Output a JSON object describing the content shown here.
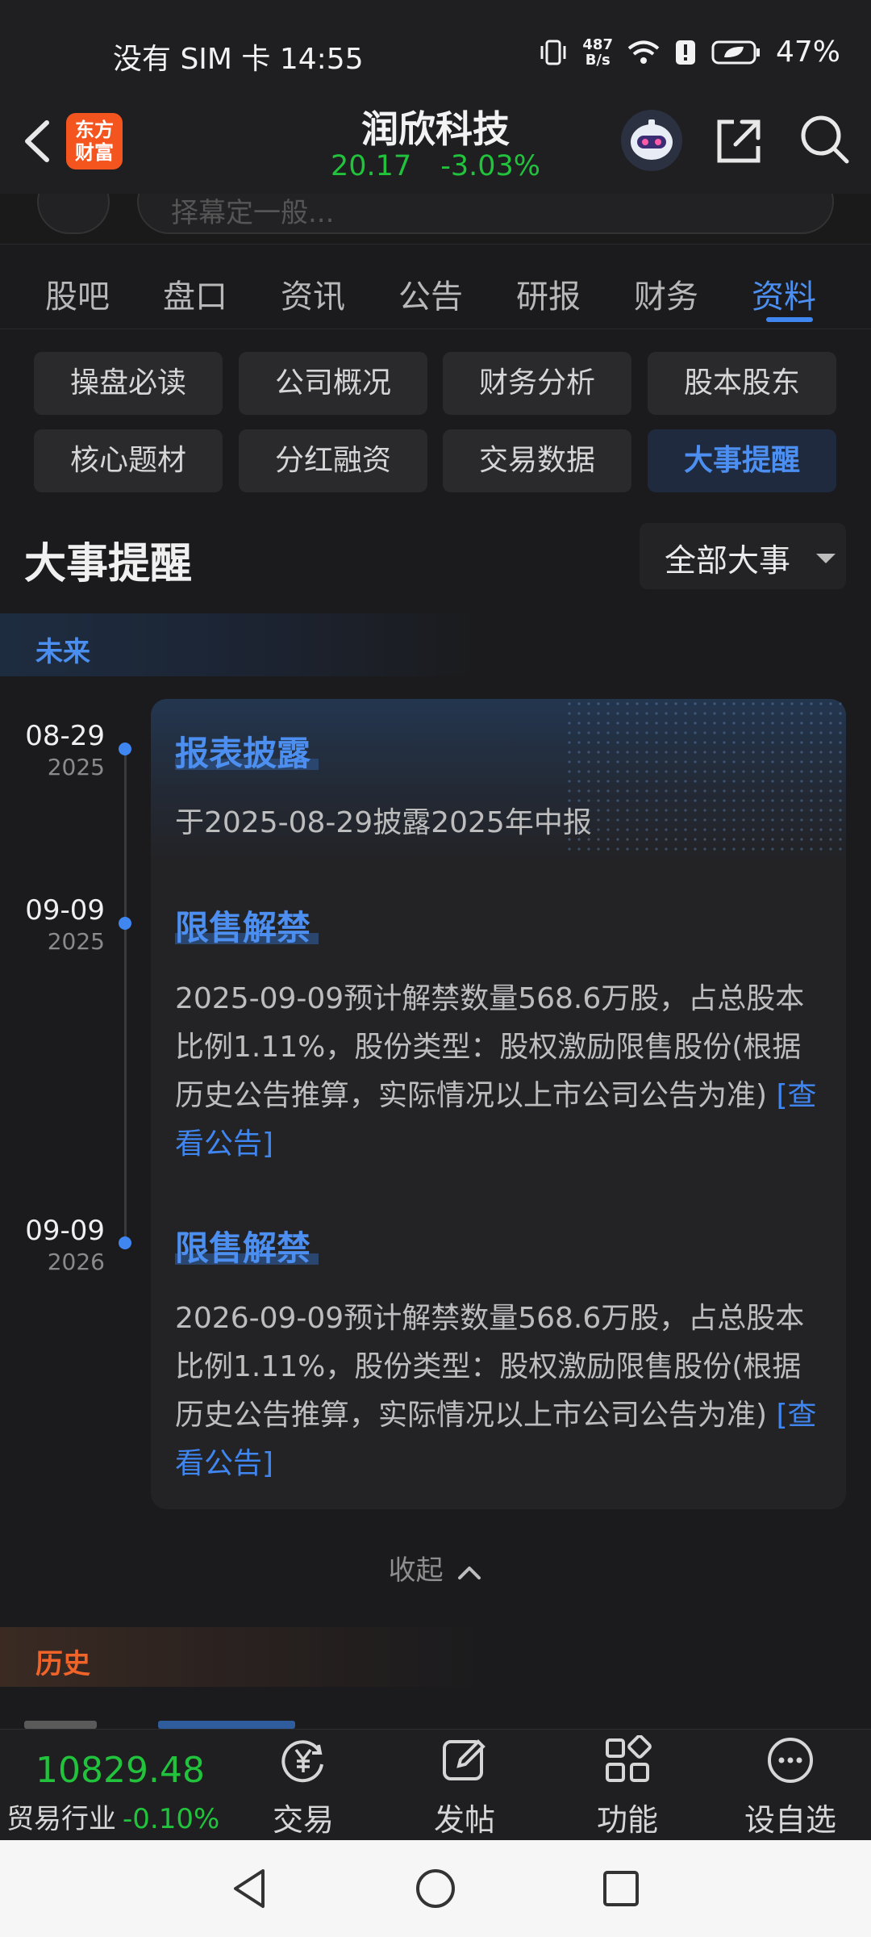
{
  "status_bar": {
    "left_text": "没有 SIM 卡 14:55",
    "net_speed_value": "487",
    "net_speed_unit": "B/s",
    "battery": "47%"
  },
  "header": {
    "logo_text": "东方\n财富",
    "stock_name": "润欣科技",
    "price": "20.17",
    "change_pct": "-3.03%"
  },
  "search_strip": {
    "placeholder_fragment": "择幕定一般..."
  },
  "tabs": [
    {
      "label": "股吧"
    },
    {
      "label": "盘口"
    },
    {
      "label": "资讯"
    },
    {
      "label": "公告"
    },
    {
      "label": "研报"
    },
    {
      "label": "财务"
    },
    {
      "label": "资料",
      "active": true
    }
  ],
  "sub_tabs": [
    {
      "label": "操盘必读"
    },
    {
      "label": "公司概况"
    },
    {
      "label": "财务分析"
    },
    {
      "label": "股本股东"
    },
    {
      "label": "核心题材"
    },
    {
      "label": "分红融资"
    },
    {
      "label": "交易数据"
    },
    {
      "label": "大事提醒",
      "active": true
    }
  ],
  "section": {
    "title": "大事提醒",
    "filter": "全部大事"
  },
  "future": {
    "label": "未来",
    "events": [
      {
        "date": "08-29",
        "year": "2025",
        "title": "报表披露",
        "text": "于2025-08-29披露2025年中报"
      },
      {
        "date": "09-09",
        "year": "2025",
        "title": "限售解禁",
        "text": "2025-09-09预计解禁数量568.6万股，占总股本比例1.11%，股份类型：股权激励限售股份(根据历史公告推算，实际情况以上市公司公告为准)",
        "link": "[查看公告]"
      },
      {
        "date": "09-09",
        "year": "2026",
        "title": "限售解禁",
        "text": "2026-09-09预计解禁数量568.6万股，占总股本比例1.11%，股份类型：股权激励限售股份(根据历史公告推算，实际情况以上市公司公告为准)",
        "link": "[查看公告]"
      }
    ],
    "collapse_label": "收起"
  },
  "history": {
    "label": "历史"
  },
  "bottom_bar": {
    "index_value": "10829.48",
    "index_label": "贸易行业",
    "index_change": "-0.10%",
    "items": [
      {
        "label": "交易"
      },
      {
        "label": "发帖"
      },
      {
        "label": "功能"
      },
      {
        "label": "设自选"
      }
    ]
  },
  "colors": {
    "accent": "#3f86f0",
    "down": "#22c33c",
    "history": "#f0642a"
  }
}
